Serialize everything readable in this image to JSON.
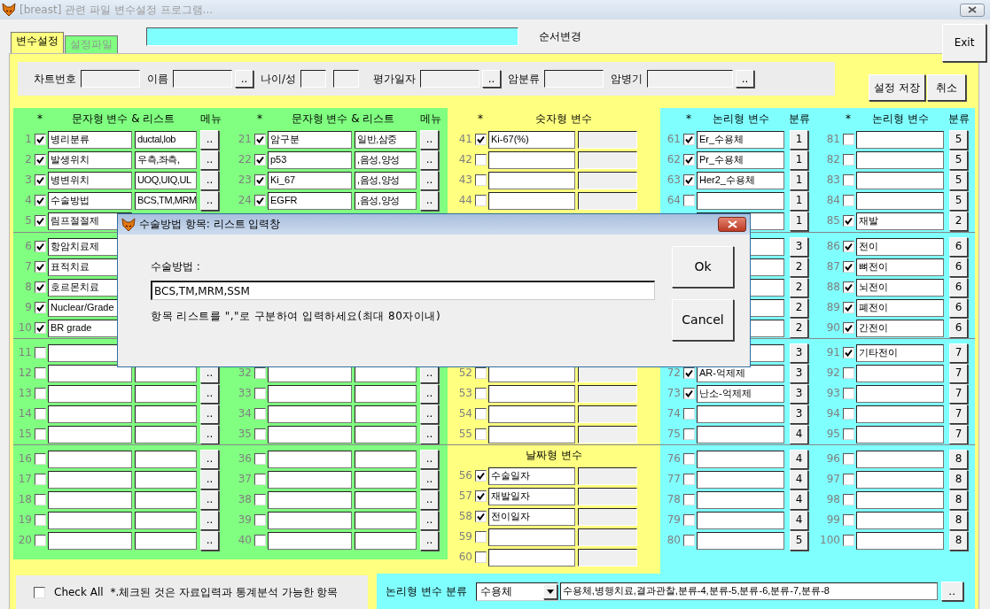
{
  "window": {
    "title": "[breast] 관련 파일 변수설정 프로그램..."
  },
  "tabs": [
    {
      "label": "변수설정",
      "selected": true
    },
    {
      "label": "설정파일",
      "selected": false
    }
  ],
  "order_label": "순서변경",
  "exit_button": "Exit",
  "top_form": [
    {
      "kind": "label",
      "text": "차트번호"
    },
    {
      "kind": "field"
    },
    {
      "kind": "label",
      "text": "이름"
    },
    {
      "kind": "field"
    },
    {
      "kind": "button",
      "text": ".."
    },
    {
      "kind": "label",
      "text": "나이/성"
    },
    {
      "kind": "small-field"
    },
    {
      "kind": "small-field"
    },
    {
      "kind": "label",
      "text": "평가일자"
    },
    {
      "kind": "field"
    },
    {
      "kind": "button",
      "text": ".."
    },
    {
      "kind": "label",
      "text": "암분류"
    },
    {
      "kind": "field"
    },
    {
      "kind": "label",
      "text": "암병기"
    },
    {
      "kind": "wide-field"
    },
    {
      "kind": "button",
      "text": ".."
    }
  ],
  "action_buttons": [
    "설정 저장",
    "취소"
  ],
  "columns": [
    {
      "kind": "text",
      "header": {
        "star": "*",
        "title": "문자형 변수 & 리스트",
        "menu": "메뉴"
      },
      "groups": [
        {
          "rows": [
            {
              "kind": "full",
              "number": "1",
              "checked": true,
              "name": "병리분류",
              "list": "ductal,lob",
              "button": ".."
            },
            {
              "kind": "full",
              "number": "2",
              "checked": true,
              "name": "발생위치",
              "list": "우측,좌측,",
              "button": ".."
            },
            {
              "kind": "full",
              "number": "3",
              "checked": true,
              "name": "병변위치",
              "list": "UOQ,UIQ,UL",
              "button": ".."
            },
            {
              "kind": "full",
              "number": "4",
              "checked": true,
              "name": "수술방법",
              "list": "BCS,TM,MRM",
              "button": ".."
            },
            {
              "kind": "left",
              "number": "5",
              "checked": true,
              "name": "림프절절제"
            }
          ]
        },
        {
          "rows": [
            {
              "kind": "left",
              "number": "6",
              "checked": true,
              "name": "항암치료제"
            },
            {
              "kind": "left",
              "number": "7",
              "checked": true,
              "name": "표적치료"
            },
            {
              "kind": "left",
              "number": "8",
              "checked": true,
              "name": "호르몬치료"
            },
            {
              "kind": "left",
              "number": "9",
              "checked": true,
              "name": "Nuclear/Grade"
            },
            {
              "kind": "left",
              "number": "10",
              "checked": true,
              "name": "BR grade"
            }
          ]
        },
        {
          "rows": [
            {
              "kind": "left",
              "number": "11",
              "checked": false
            },
            {
              "kind": "full",
              "number": "12",
              "checked": false,
              "button": ".."
            },
            {
              "kind": "full",
              "number": "13",
              "checked": false,
              "button": ".."
            },
            {
              "kind": "full",
              "number": "14",
              "checked": false,
              "button": ".."
            },
            {
              "kind": "full",
              "number": "15",
              "checked": false,
              "button": ".."
            }
          ]
        },
        {
          "rows": [
            {
              "kind": "full",
              "number": "16",
              "checked": false,
              "button": ".."
            },
            {
              "kind": "full",
              "number": "17",
              "checked": false,
              "button": ".."
            },
            {
              "kind": "full",
              "number": "18",
              "checked": false,
              "button": ".."
            },
            {
              "kind": "full",
              "number": "19",
              "checked": false,
              "button": ".."
            },
            {
              "kind": "full",
              "number": "20",
              "checked": false,
              "button": ".."
            }
          ]
        }
      ]
    },
    {
      "kind": "text",
      "header": {
        "star": "*",
        "title": "문자형 변수 & 리스트",
        "menu": "메뉴"
      },
      "groups": [
        {
          "rows": [
            {
              "kind": "full",
              "number": "21",
              "checked": true,
              "name": "암구분",
              "list": "일반,삼중",
              "button": ".."
            },
            {
              "kind": "full",
              "number": "22",
              "checked": true,
              "name": "p53",
              "list": ",음성,양성",
              "button": ".."
            },
            {
              "kind": "full",
              "number": "23",
              "checked": true,
              "name": "Ki_67",
              "list": ",음성,양성",
              "button": ".."
            },
            {
              "kind": "full",
              "number": "24",
              "checked": true,
              "name": "EGFR",
              "list": ",음성,양성",
              "button": ".."
            },
            {
              "kind": "covered"
            }
          ]
        },
        {
          "rows": [
            {
              "kind": "covered"
            },
            {
              "kind": "covered"
            },
            {
              "kind": "covered"
            },
            {
              "kind": "covered"
            },
            {
              "kind": "covered"
            }
          ]
        },
        {
          "rows": [
            {
              "kind": "covered"
            },
            {
              "kind": "full",
              "number": "32",
              "checked": false,
              "button": ".."
            },
            {
              "kind": "full",
              "number": "33",
              "checked": false,
              "button": ".."
            },
            {
              "kind": "full",
              "number": "34",
              "checked": false,
              "button": ".."
            },
            {
              "kind": "full",
              "number": "35",
              "checked": false,
              "button": ".."
            }
          ]
        },
        {
          "rows": [
            {
              "kind": "full",
              "number": "36",
              "checked": false,
              "button": ".."
            },
            {
              "kind": "full",
              "number": "37",
              "checked": false,
              "button": ".."
            },
            {
              "kind": "full",
              "number": "38",
              "checked": false,
              "button": ".."
            },
            {
              "kind": "full",
              "number": "39",
              "checked": false,
              "button": ".."
            },
            {
              "kind": "full",
              "number": "40",
              "checked": false,
              "button": ".."
            }
          ]
        }
      ]
    },
    {
      "kind": "numeric",
      "header": {
        "star": "*",
        "title": "숫자형 변수"
      },
      "groups": [
        {
          "rows": [
            {
              "kind": "full",
              "number": "41",
              "checked": true,
              "name": "Ki-67(%)"
            },
            {
              "kind": "full",
              "number": "42",
              "checked": false
            },
            {
              "kind": "full",
              "number": "43",
              "checked": false
            },
            {
              "kind": "full",
              "number": "44",
              "checked": false
            },
            {
              "kind": "covered"
            }
          ]
        },
        {
          "rows": [
            {
              "kind": "covered"
            },
            {
              "kind": "covered"
            },
            {
              "kind": "covered"
            },
            {
              "kind": "covered"
            },
            {
              "kind": "covered"
            }
          ]
        },
        {
          "rows": [
            {
              "kind": "covered"
            },
            {
              "kind": "full",
              "number": "52",
              "checked": false
            },
            {
              "kind": "full",
              "number": "53",
              "checked": false
            },
            {
              "kind": "full",
              "number": "54",
              "checked": false
            },
            {
              "kind": "full",
              "number": "55",
              "checked": false
            }
          ]
        },
        {
          "title": "날짜형 변수",
          "rows": [
            {
              "kind": "full",
              "number": "56",
              "checked": true,
              "name": "수술일자"
            },
            {
              "kind": "full",
              "number": "57",
              "checked": true,
              "name": "재발일자"
            },
            {
              "kind": "full",
              "number": "58",
              "checked": true,
              "name": "전이일자"
            },
            {
              "kind": "full",
              "number": "59",
              "checked": false
            },
            {
              "kind": "full",
              "number": "60",
              "checked": false
            }
          ]
        }
      ]
    },
    {
      "kind": "logic",
      "header": {
        "star": "*",
        "title": "논리형 변수",
        "menu": "분류"
      },
      "groups": [
        {
          "rows": [
            {
              "kind": "full",
              "number": "61",
              "checked": true,
              "name": "Er_수용체",
              "button": "1"
            },
            {
              "kind": "full",
              "number": "62",
              "checked": true,
              "name": "Pr_수용체",
              "button": "1"
            },
            {
              "kind": "full",
              "number": "63",
              "checked": true,
              "name": "Her2_수용체",
              "button": "1"
            },
            {
              "kind": "full",
              "number": "64",
              "checked": false,
              "button": "1"
            },
            {
              "kind": "right",
              "button": "1"
            }
          ]
        },
        {
          "rows": [
            {
              "kind": "right",
              "button": "3"
            },
            {
              "kind": "right",
              "button": "2"
            },
            {
              "kind": "right",
              "button": "2"
            },
            {
              "kind": "right",
              "button": "2"
            },
            {
              "kind": "right",
              "button": "2"
            }
          ]
        },
        {
          "rows": [
            {
              "kind": "right",
              "button": "3"
            },
            {
              "kind": "full",
              "number": "72",
              "checked": true,
              "name": "AR-억제제",
              "button": "3"
            },
            {
              "kind": "full",
              "number": "73",
              "checked": true,
              "name": "난소-억제제",
              "button": "3"
            },
            {
              "kind": "full",
              "number": "74",
              "checked": false,
              "button": "3"
            },
            {
              "kind": "full",
              "number": "75",
              "checked": false,
              "button": "4"
            }
          ]
        },
        {
          "rows": [
            {
              "kind": "full",
              "number": "76",
              "checked": false,
              "button": "4"
            },
            {
              "kind": "full",
              "number": "77",
              "checked": false,
              "button": "4"
            },
            {
              "kind": "full",
              "number": "78",
              "checked": false,
              "button": "4"
            },
            {
              "kind": "full",
              "number": "79",
              "checked": false,
              "button": "4"
            },
            {
              "kind": "full",
              "number": "80",
              "checked": false,
              "button": "5"
            }
          ]
        }
      ]
    },
    {
      "kind": "logic",
      "header": {
        "star": "*",
        "title": "논리형 변수",
        "menu": "분류"
      },
      "groups": [
        {
          "rows": [
            {
              "kind": "full",
              "number": "81",
              "checked": false,
              "button": "5"
            },
            {
              "kind": "full",
              "number": "82",
              "checked": false,
              "button": "5"
            },
            {
              "kind": "full",
              "number": "83",
              "checked": false,
              "button": "5"
            },
            {
              "kind": "full",
              "number": "84",
              "checked": false,
              "button": "5"
            },
            {
              "kind": "full",
              "number": "85",
              "checked": true,
              "name": "재발",
              "button": "2"
            }
          ]
        },
        {
          "rows": [
            {
              "kind": "full",
              "number": "86",
              "checked": true,
              "name": "전이",
              "button": "6"
            },
            {
              "kind": "full",
              "number": "87",
              "checked": true,
              "name": "뼈전이",
              "button": "6"
            },
            {
              "kind": "full",
              "number": "88",
              "checked": true,
              "name": "뇌전이",
              "button": "6"
            },
            {
              "kind": "full",
              "number": "89",
              "checked": true,
              "name": "폐전이",
              "button": "6"
            },
            {
              "kind": "full",
              "number": "90",
              "checked": true,
              "name": "간전이",
              "button": "6"
            }
          ]
        },
        {
          "rows": [
            {
              "kind": "full",
              "number": "91",
              "checked": true,
              "name": "기타전이",
              "button": "7"
            },
            {
              "kind": "full",
              "number": "92",
              "checked": false,
              "button": "7"
            },
            {
              "kind": "full",
              "number": "93",
              "checked": false,
              "button": "7"
            },
            {
              "kind": "full",
              "number": "94",
              "checked": false,
              "button": "7"
            },
            {
              "kind": "full",
              "number": "95",
              "checked": false,
              "button": "7"
            }
          ]
        },
        {
          "rows": [
            {
              "kind": "full",
              "number": "96",
              "checked": false,
              "button": "8"
            },
            {
              "kind": "full",
              "number": "97",
              "checked": false,
              "button": "8"
            },
            {
              "kind": "full",
              "number": "98",
              "checked": false,
              "button": "8"
            },
            {
              "kind": "full",
              "number": "99",
              "checked": false,
              "button": "8"
            },
            {
              "kind": "full",
              "number": "100",
              "checked": false,
              "button": "8"
            }
          ]
        }
      ]
    }
  ],
  "check_all": {
    "checked": false,
    "label": "Check All",
    "note": "*.체크된 것은 자료입력과 통계분석 가능한 항목"
  },
  "classification": {
    "label": "논리형 변수 분류",
    "select": "수용체",
    "list": "수용체,병행치료,결과관찰,분류-4,분류-5,분류-6,분류-7,분류-8",
    "button": ".."
  },
  "dialog": {
    "title": "수술방법 항목: 리스트 입력창",
    "label": "수술방법 :",
    "value": "BCS,TM,MRM,SSM",
    "hint": "항목 리스트를 \",\"로 구분하여 입력하세요(최대 80자이내)",
    "buttons": [
      "Ok",
      "Cancel"
    ]
  }
}
